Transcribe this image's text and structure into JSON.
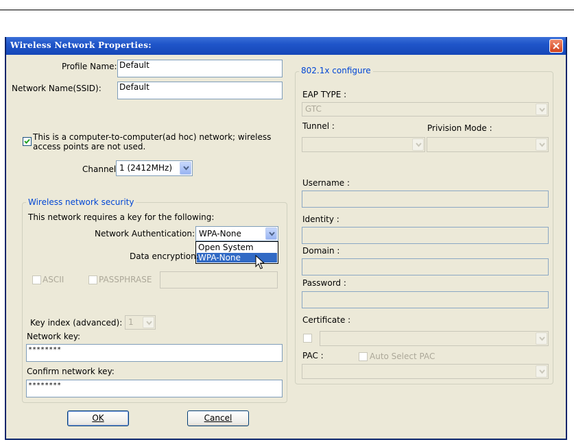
{
  "dialog": {
    "title": "Wireless Network Properties:"
  },
  "left": {
    "profile_label": "Profile Name:",
    "profile_value": "Default",
    "ssid_label": "Network Name(SSID):",
    "ssid_value": "Default",
    "adhoc_line1": "This is a computer-to-computer(ad hoc) network; wireless",
    "adhoc_line2": "access points are not used.",
    "adhoc_checked": true,
    "channel_label": "Channel:",
    "channel_value": "1  (2412MHz)"
  },
  "security": {
    "group_title": "Wireless network security",
    "requires_text": "This network requires a key for the following:",
    "auth_label": "Network Authentication:",
    "auth_value": "WPA-None",
    "auth_options": [
      "Open System",
      "WPA-None"
    ],
    "encryption_label": "Data encryption:",
    "ascii_label": "ASCII",
    "passphrase_label": "PASSPHRASE",
    "key_index_label": "Key index (advanced):",
    "key_index_value": "1",
    "network_key_label": "Network key:",
    "network_key_value": "********",
    "confirm_key_label": "Confirm network key:",
    "confirm_key_value": "********"
  },
  "eap": {
    "group_title": "802.1x configure",
    "eap_type_label": "EAP TYPE :",
    "eap_type_value": "GTC",
    "tunnel_label": "Tunnel :",
    "provision_label": "Privision Mode :",
    "username_label": "Username :",
    "identity_label": "Identity :",
    "domain_label": "Domain :",
    "password_label": "Password :",
    "certificate_label": "Certificate :",
    "pac_label": "PAC :",
    "auto_pac_label": "Auto Select PAC"
  },
  "buttons": {
    "ok_label": "OK",
    "cancel_label": "Cancel"
  },
  "icons": {
    "close": "close-icon",
    "dropdown_arrow": "chevron-down-icon",
    "check": "check-icon",
    "cursor": "mouse-pointer-icon"
  },
  "colors": {
    "titlebar": "#1f55c9",
    "dialog_bg": "#ece9d8",
    "group_title": "#0046d5",
    "selection": "#316ac5"
  }
}
